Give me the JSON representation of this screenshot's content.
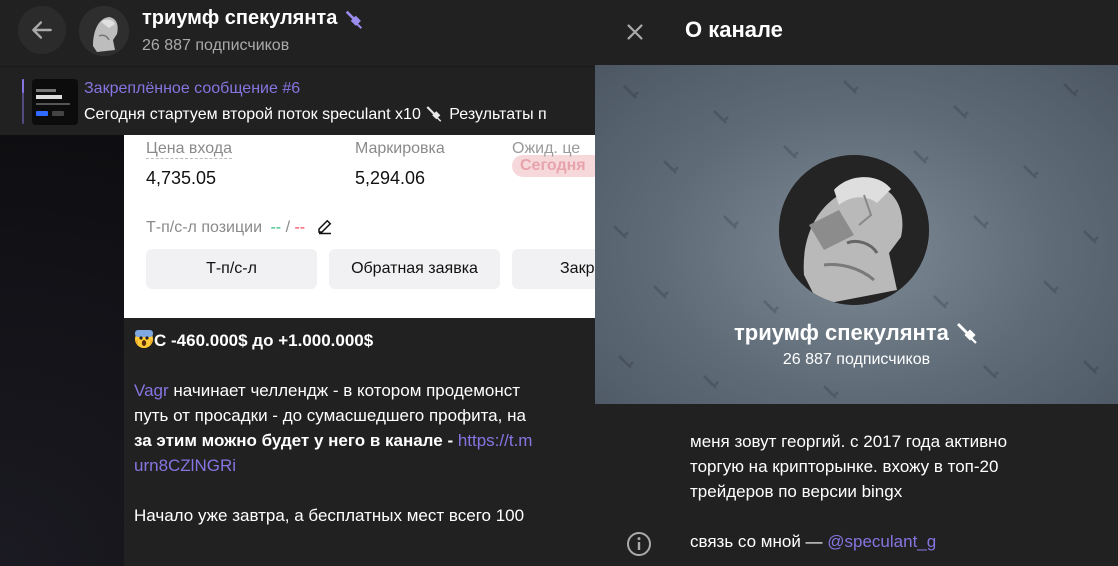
{
  "header": {
    "title": "триумф спекулянта",
    "subscribers": "26 887 подписчиков"
  },
  "pinned": {
    "title": "Закреплённое сообщение #6",
    "text": "Сегодня стартуем второй поток speculant x10 ",
    "text_tail": "Результаты п"
  },
  "screenshot": {
    "entry_label": "Цена входа",
    "entry_value": "4,735.05",
    "mark_label": "Маркировка",
    "mark_value": "5,294.06",
    "expected_label": "Ожид. це",
    "today_tag": "Сегодня",
    "tpsl_label": "Т-п/с-л позиции",
    "tpsl_tp": "--",
    "tpsl_sep": " / ",
    "tpsl_sl": "--",
    "btn_tpsl": "Т-п/с-л",
    "btn_reverse": "Обратная заявка",
    "btn_close": "Закр"
  },
  "message": {
    "headline": "С -460.000$ до +1.000.000$",
    "line2_link": "Vagr",
    "line2_rest": " начинает челлендж - в котором продемонст",
    "line3": "путь от просадки - до сумасшедшего профита, на",
    "line4_bold": "за этим можно будет у него в канале",
    "line4_dash": " - ",
    "line4_link": "https://t.m",
    "line5_link": "urn8CZlNGRi",
    "line6": "Начало уже завтра, а бесплатных мест всего 100"
  },
  "panel": {
    "title": "О канале",
    "channel_name": "триумф спекулянта",
    "subscribers": "26 887 подписчиков",
    "bio_1": "меня зовут георгий. с 2017 года активно",
    "bio_2": "торгую на крипторынке. вхожу в топ-20",
    "bio_3": "трейдеров по версии bingx",
    "contact_prefix": "связь со мной — ",
    "contact_link": "@speculant_g"
  },
  "colors": {
    "accent": "#8774e1",
    "panel_bg": "#212121",
    "chat_bg": "#0f0f12",
    "cover": "#6b7884",
    "tp_green": "#2ebd85",
    "sl_red": "#f6465d"
  },
  "icons": [
    "back-arrow-icon",
    "sword-badge-icon",
    "close-icon",
    "pencil-icon",
    "info-icon",
    "scream-emoji-icon"
  ]
}
